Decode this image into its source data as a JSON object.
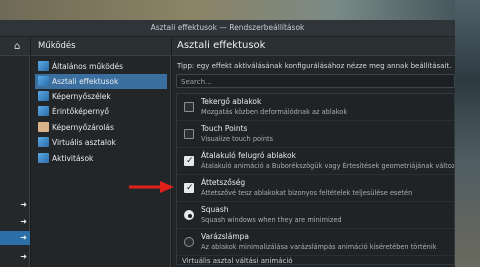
{
  "window": {
    "title": "Asztali effektusok — Rendszerbeállítások"
  },
  "tree": {
    "home_icon": "home-icon",
    "arrow_icon": "arrow-right-icon"
  },
  "categories": {
    "header": "Működés",
    "items": [
      {
        "label": "Általános működés",
        "icon": "general-behavior-icon"
      },
      {
        "label": "Asztali effektusok",
        "icon": "desktop-effects-icon",
        "selected": true
      },
      {
        "label": "Képernyőszélek",
        "icon": "screen-edges-icon"
      },
      {
        "label": "Érintőképernyő",
        "icon": "touchscreen-icon"
      },
      {
        "label": "Képernyőzárolás",
        "icon": "screen-lock-icon"
      },
      {
        "label": "Virtuális asztalok",
        "icon": "virtual-desktops-icon"
      },
      {
        "label": "Aktivitások",
        "icon": "activities-icon"
      }
    ]
  },
  "main": {
    "title": "Asztali effektusok",
    "tip": "Tipp: egy effekt aktiválásának konfigurálásához nézze meg annak beállításait.",
    "search_placeholder": "Search...",
    "effects": [
      {
        "name": "Tekergő ablakok",
        "desc": "Mozgatás közben deformálódnak az ablakok",
        "control": "checkbox",
        "checked": false
      },
      {
        "name": "Touch Points",
        "desc": "Visualize touch points",
        "control": "checkbox",
        "checked": false
      },
      {
        "name": "Átalakuló felugró ablakok",
        "desc": "Átalakuló animáció a Buborékszögük vagy Értesítések geometriájának változtatásakor",
        "control": "checkbox",
        "checked": true
      },
      {
        "name": "Áttetszőség",
        "desc": "Áttetszővé tesz ablakokat bizonyos feltételek teljesülése esetén",
        "control": "checkbox",
        "checked": true
      },
      {
        "name": "Squash",
        "desc": "Squash windows when they are minimized",
        "control": "radio",
        "checked": true
      },
      {
        "name": "Varázslámpa",
        "desc": "Az ablakok minimalizálása varázslámpás animáció kíséretében történik",
        "control": "radio",
        "checked": false
      }
    ],
    "footer_partial": "Virtuális asztal váltási animáció"
  },
  "colors": {
    "accent": "#2c6fa8",
    "annotation_arrow": "#e0201b"
  }
}
